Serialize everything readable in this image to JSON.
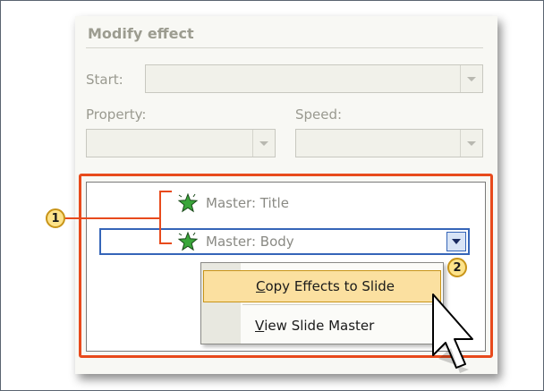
{
  "panel": {
    "title": "Modify effect",
    "start_label": "Start:",
    "property_label": "Property:",
    "speed_label": "Speed:"
  },
  "list": {
    "items": [
      {
        "label": "Master: Title",
        "icon": "star-effect-icon"
      },
      {
        "label": "Master: Body",
        "icon": "star-effect-icon"
      }
    ]
  },
  "context_menu": {
    "items": [
      {
        "accel": "C",
        "rest": "opy Effects to Slide",
        "highlighted": true
      },
      {
        "accel": "V",
        "rest": "iew Slide Master",
        "highlighted": false
      }
    ]
  },
  "callouts": {
    "one": "1",
    "two": "2"
  },
  "colors": {
    "highlight_red": "#e84a1c",
    "selection_blue": "#3565b8",
    "menu_highlight": "#fbe0a0",
    "callout_fill": "#fde38a"
  }
}
